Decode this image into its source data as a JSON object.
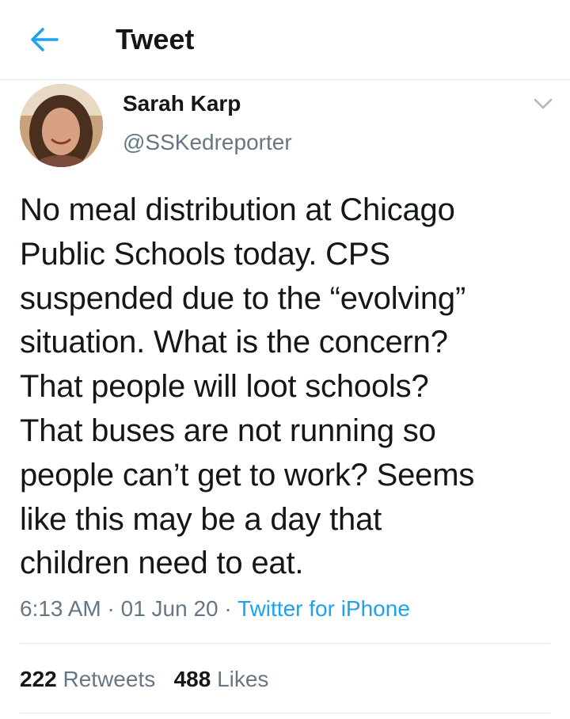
{
  "header": {
    "title": "Tweet",
    "back_icon": "arrow-left-icon"
  },
  "colors": {
    "accent": "#1da1f2",
    "secondary_text": "#657786",
    "divider": "#e1e8ed"
  },
  "author": {
    "name": "Sarah Karp",
    "handle": "@SSKedreporter"
  },
  "tweet": {
    "lines": [
      "No meal distribution at Chicago",
      "Public Schools today. CPS",
      "suspended due to the “evolving”",
      "situation. What is the concern?",
      "That people will loot schools?",
      "That buses are not running so",
      "people can’t get to work? Seems",
      "like this may be a day that",
      "children need to eat."
    ],
    "time": "6:13 AM",
    "date": "01 Jun 20",
    "separator": "·",
    "source": "Twitter for iPhone"
  },
  "stats": {
    "retweets_count": "222",
    "retweets_label": "Retweets",
    "likes_count": "488",
    "likes_label": "Likes"
  }
}
